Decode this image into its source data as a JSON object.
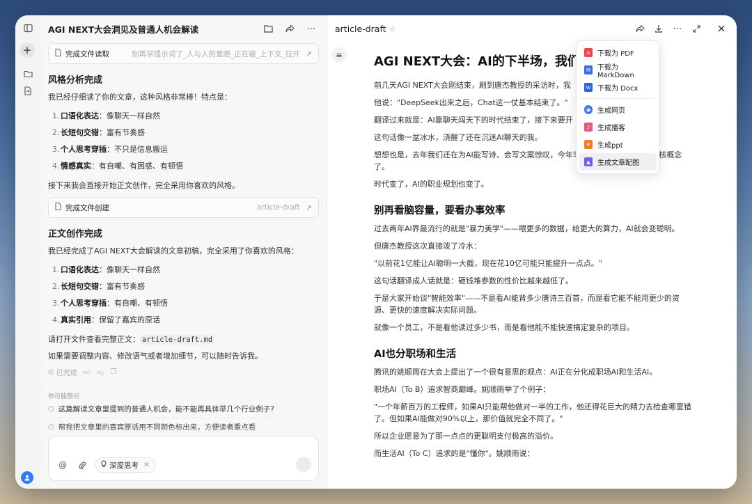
{
  "chat": {
    "title": "AGI NEXT大会洞见及普通人机会解读",
    "file_read": {
      "label": "完成文件读取",
      "desc": "别再学提示词了_人与人的差距_正在被_上下文_拉开"
    },
    "section1": {
      "title": "风格分析完成",
      "intro": "我已经仔细读了你的文章，这种风格非常棒！特点是：",
      "items": [
        {
          "num": "1.",
          "bold": "口语化表达",
          "text": "：像聊天一样自然"
        },
        {
          "num": "2.",
          "bold": "长短句交错",
          "text": "：富有节奏感"
        },
        {
          "num": "3.",
          "bold": "个人思考穿插",
          "text": "：不只是信息搬运"
        },
        {
          "num": "4.",
          "bold": "情感真实",
          "text": "：有自嘲、有困惑、有顿悟"
        }
      ],
      "outro": "接下来我会直接开始正文创作，完全采用你喜欢的风格。"
    },
    "file_create": {
      "label": "完成文件创建",
      "desc": "article-draft"
    },
    "section2": {
      "title": "正文创作完成",
      "intro": "我已经完成了AGI NEXT大会解读的文章初稿，完全采用了你喜欢的风格：",
      "items": [
        {
          "num": "1.",
          "bold": "口语化表达",
          "text": "：像聊天一样自然"
        },
        {
          "num": "2.",
          "bold": "长短句交错",
          "text": "：富有节奏感"
        },
        {
          "num": "3.",
          "bold": "个人思考穿插",
          "text": "：有自嘲、有顿悟"
        },
        {
          "num": "4.",
          "bold": "真实引用",
          "text": "：保留了嘉宾的原话"
        }
      ],
      "open_prefix": "请打开文件查看完整正文：",
      "open_file": "article-draft.md",
      "outro": "如果需要调整内容、修改语气或者增加细节，可以随时告诉我。"
    },
    "status": "已完成",
    "suggest_label": "你可能想问",
    "suggestions": [
      "这篇解读文章里提到的普通人机会，能不能再具体举几个行业例子?",
      "帮我把文章里的嘉宾原话用不同颜色标出来，方便读者重点看"
    ],
    "input": {
      "deep_think": "深度思考"
    }
  },
  "doc": {
    "title": "article-draft",
    "menu": [
      {
        "label": "下载为 PDF",
        "icon": "pdf-icon",
        "color": "#e5484d"
      },
      {
        "label": "下载为 MarkDown",
        "icon": "markdown-icon",
        "color": "#3b6fe0"
      },
      {
        "label": "下载为 Docx",
        "icon": "docx-icon",
        "color": "#2b63d9"
      },
      {
        "label": "生成网页",
        "icon": "web-icon",
        "color": "#4a78e8"
      },
      {
        "label": "生成播客",
        "icon": "podcast-icon",
        "color": "#e05a8a"
      },
      {
        "label": "生成ppt",
        "icon": "ppt-icon",
        "color": "#ef7d2a"
      },
      {
        "label": "生成文章配图",
        "icon": "image-icon",
        "color": "#7a5ce0"
      }
    ],
    "article": {
      "h1": "AGI NEXT大会：AI的下半场，我们讨",
      "p1": "前几天AGI NEXT大会刚结束，刷到唐杰教授的采访时，我",
      "p2": "他说：\"DeepSeek出来之后，Chat这一仗基本结束了。\"",
      "p3": "翻译过来就是：AI靠聊天闯天下的时代结束了，接下来要开",
      "p4": "这句话像一盆冰水，浇醒了还在沉迷AI聊天的我。",
      "p5": "想想也是，去年我们还在为AI能写诗、会写文案惊叹，今年率\"、\"Token效率\"这些硬核概念了。",
      "p6": "时代变了，AI的职业规划也变了。",
      "h2a": "别再看脑容量，要看办事效率",
      "p7": "过去两年AI界最流行的就是\"暴力美学\"——喂更多的数据，给更大的算力，AI就会变聪明。",
      "p8": "但唐杰教授这次直接泼了冷水：",
      "p9": "\"以前花1亿能让AI聪明一大截，现在花10亿可能只能提升一点点。\"",
      "p10": "这句话翻译成人话就是：砸钱堆参数的性价比越来越低了。",
      "p11": "于是大家开始谈\"智能效率\"——不是看AI能背多少唐诗三百首，而是看它能不能用更少的资源、更快的速度解决实际问题。",
      "p12": "就像一个员工，不是看他读过多少书，而是看他能不能快速搞定复杂的项目。",
      "h2b": "AI也分职场和生活",
      "p13": "腾讯的姚顺雨在大会上提出了一个很有意思的观点：AI正在分化成职场AI和生活AI。",
      "p14": "职场AI（To B）追求智商巅峰。姚顺雨举了个例子：",
      "p15": "\"一个年薪百万的工程师，如果AI只能帮他做对一半的工作，他还得花巨大的精力去检查哪里错了。但如果AI能做对90%以上，那价值就完全不同了。\"",
      "p16": "所以企业愿意为了那一点点的更聪明支付极高的溢价。",
      "p17": "而生活AI（To C）追求的是\"懂你\"。姚顺雨说："
    }
  }
}
